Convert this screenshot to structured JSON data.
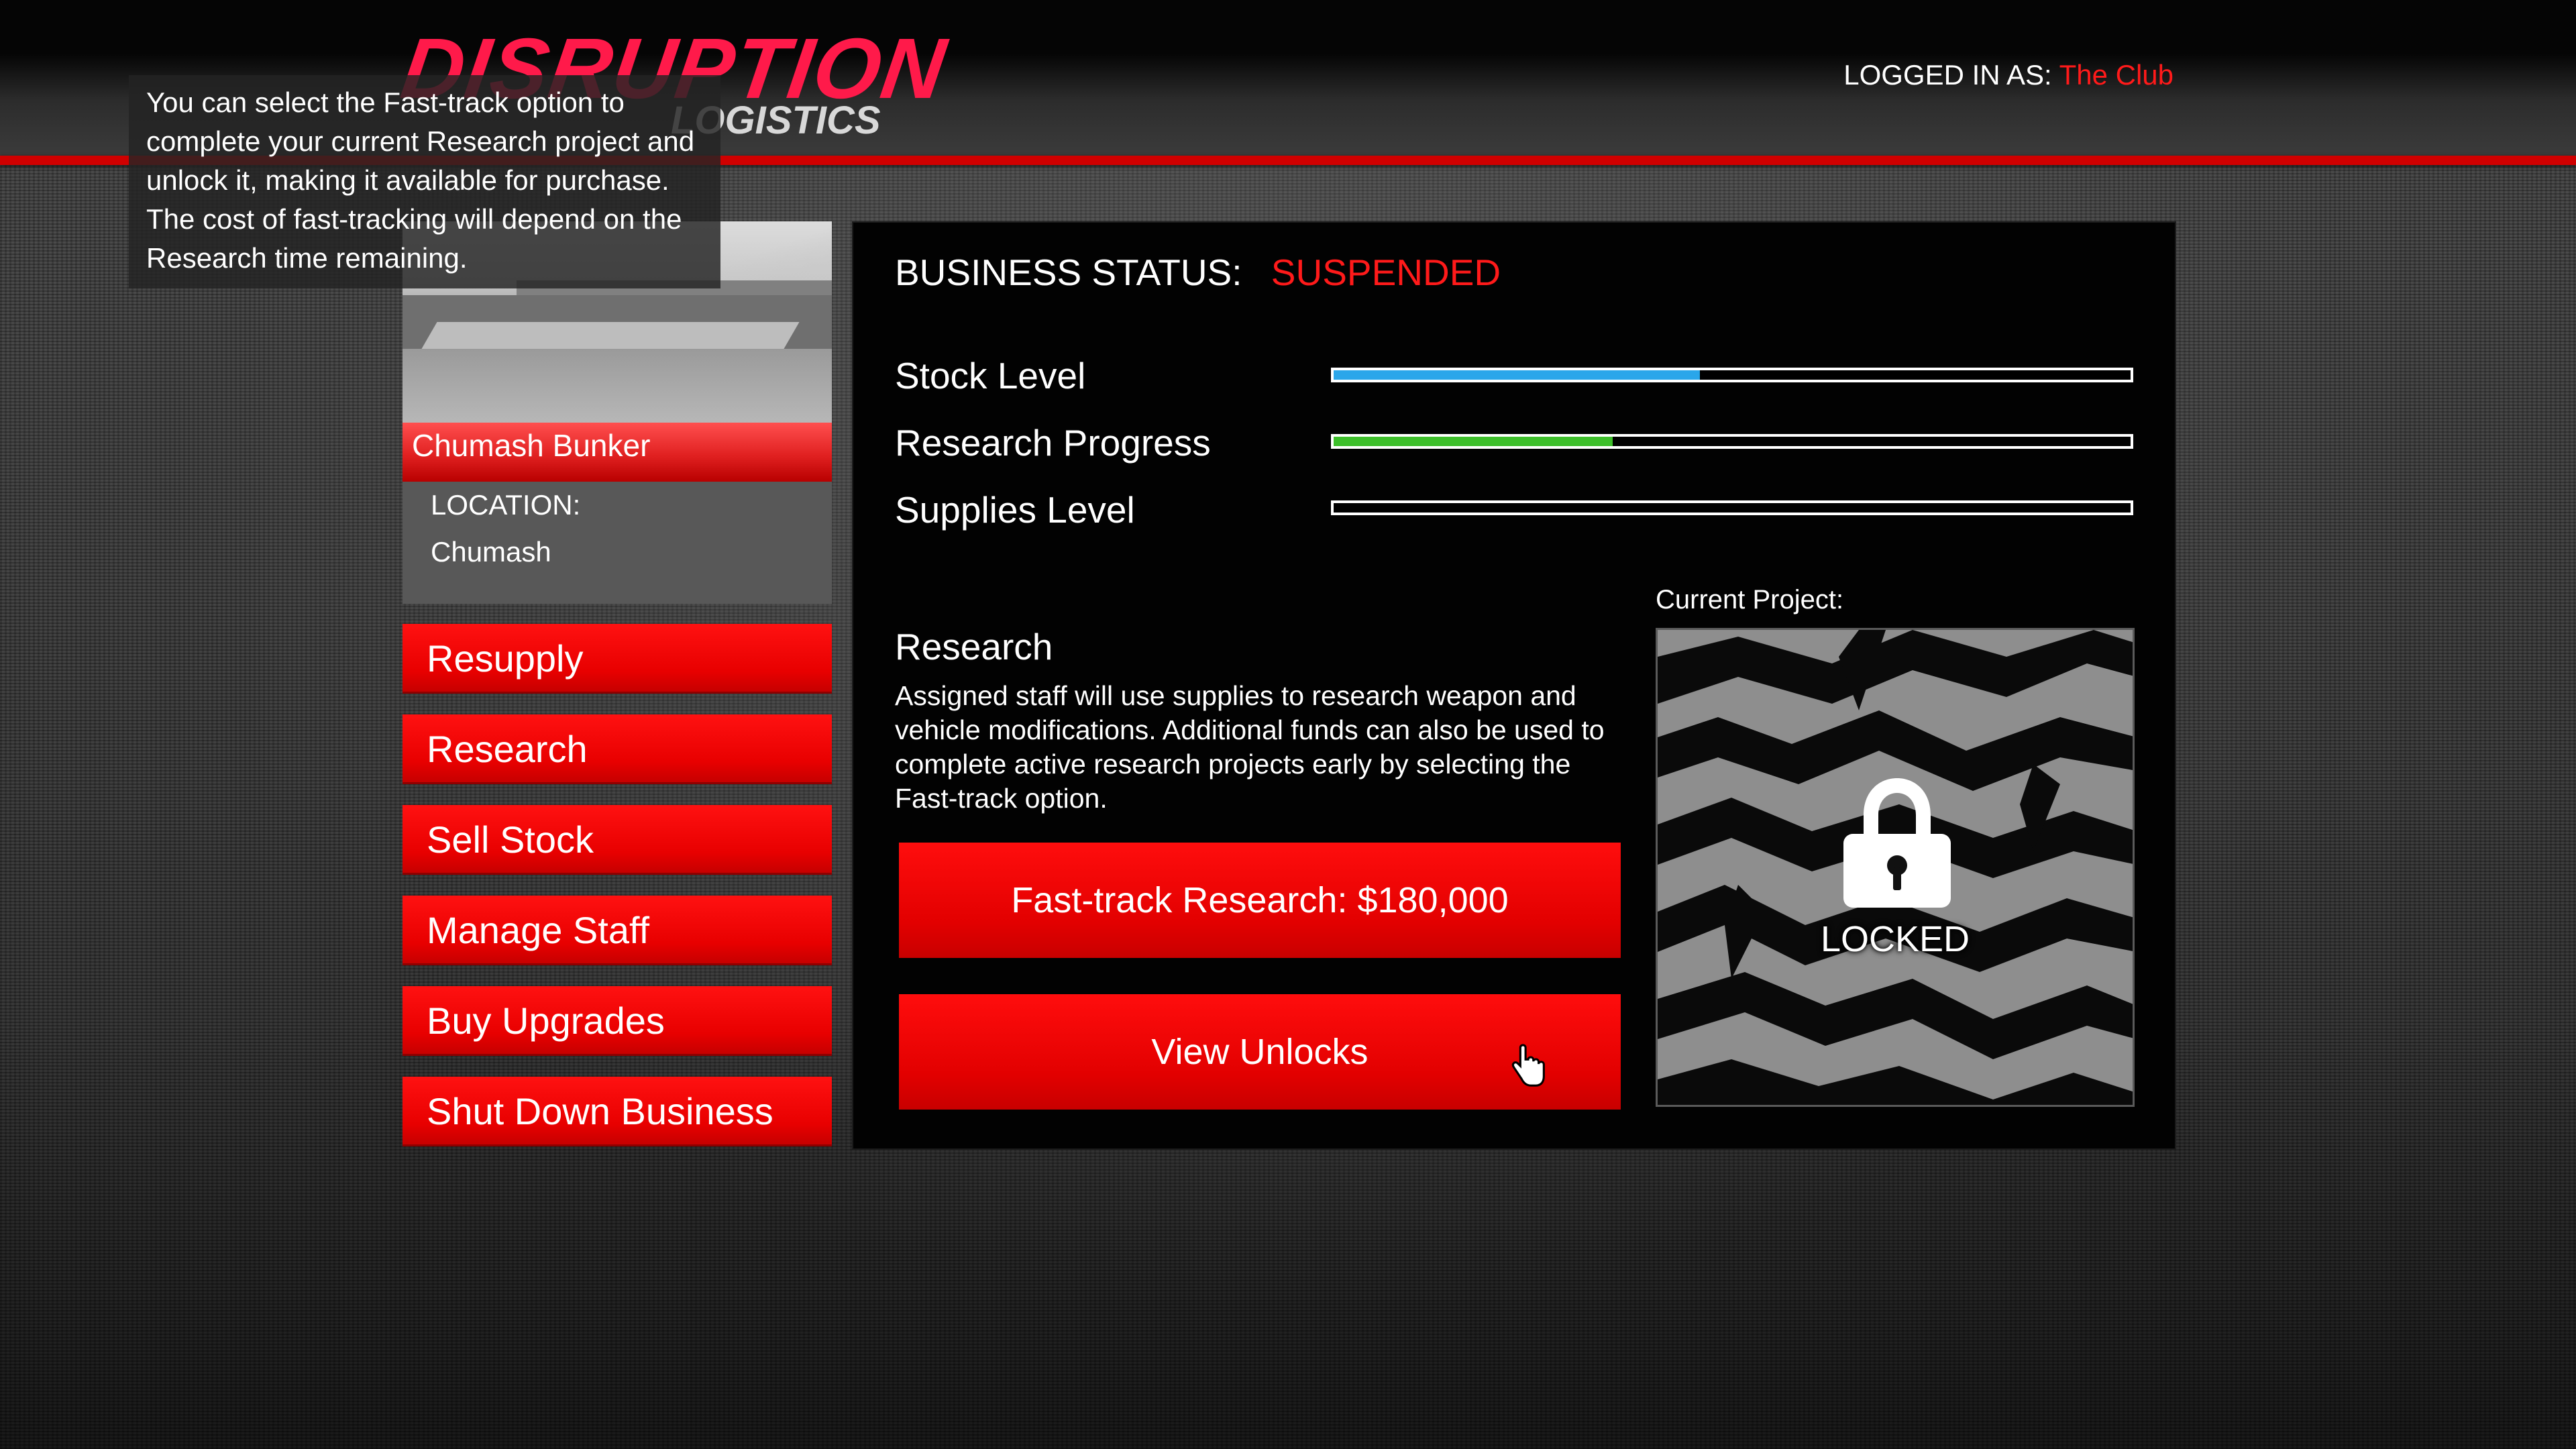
{
  "header": {
    "logo_main": "DISRUPTION",
    "logo_sub": "LOGISTICS",
    "login_label": "LOGGED IN AS:",
    "login_user": "The Club"
  },
  "tooltip": {
    "text": "You can select the Fast-track option to complete your current Research project and unlock it, making it available for purchase. The cost of fast-tracking will depend on the Research time remaining."
  },
  "location": {
    "name": "Chumash Bunker",
    "label": "LOCATION:",
    "value": "Chumash"
  },
  "menu": {
    "items": [
      {
        "label": "Resupply"
      },
      {
        "label": "Research"
      },
      {
        "label": "Sell Stock"
      },
      {
        "label": "Manage Staff"
      },
      {
        "label": "Buy Upgrades"
      },
      {
        "label": "Shut Down Business"
      }
    ]
  },
  "status": {
    "label": "BUSINESS STATUS:",
    "value": "SUSPENDED",
    "value_color": "#ff1a1a"
  },
  "stats": [
    {
      "label": "Stock Level",
      "fraction": 0.46,
      "color": "#2aa6ea"
    },
    {
      "label": "Research Progress",
      "fraction": 0.35,
      "color": "#3dbf2a"
    },
    {
      "label": "Supplies Level",
      "fraction": 0.0,
      "color": "#ffffff"
    }
  ],
  "research": {
    "title": "Research",
    "description": "Assigned staff will use supplies to research weapon and vehicle modifications. Additional funds can also be used to complete active research projects early by selecting the Fast-track option.",
    "fast_track_label": "Fast-track Research: $180,000",
    "view_unlocks_label": "View Unlocks"
  },
  "project": {
    "label": "Current Project:",
    "status": "LOCKED"
  },
  "colors": {
    "accent": "#e80000",
    "logo": "#ff1a4a"
  },
  "icons": {
    "lock": "padlock-icon",
    "cursor": "hand-pointer-icon"
  }
}
